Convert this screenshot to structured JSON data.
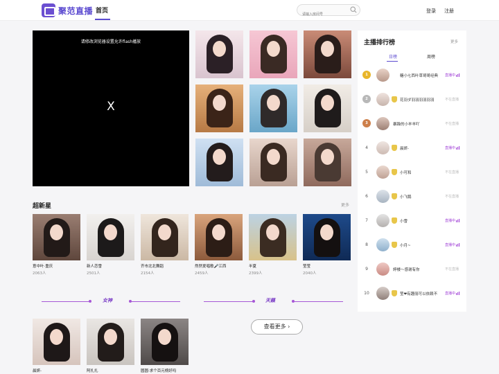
{
  "header": {
    "logo_text": "聚范直播",
    "nav_home": "首页",
    "search_placeholder": "请输入房间号",
    "login": "登录",
    "register": "注册"
  },
  "player": {
    "message": "请修改浏览器设置允许flash播放",
    "close_glyph": "X"
  },
  "section": {
    "title": "超新星",
    "more": "更多"
  },
  "stars": [
    {
      "name": "意中叶·重庆",
      "count": "2063人"
    },
    {
      "name": "新人恋雪",
      "count": "2501人"
    },
    {
      "name": "齐市北北舞蹈",
      "count": "2154人"
    },
    {
      "name": "然然爱唱歌🎤江西",
      "count": "2459人"
    },
    {
      "name": "半夏",
      "count": "2399人"
    },
    {
      "name": "莹莹",
      "count": "2040人"
    }
  ],
  "dividers": {
    "left": "女神",
    "right": "天籁"
  },
  "bottom_cards": [
    {
      "name": "晨妍-"
    },
    {
      "name": "阿扎扎"
    },
    {
      "name": "圆圆·求个百元榜好吗"
    }
  ],
  "more_button": "查看更多",
  "ranking": {
    "title": "主播排行榜",
    "more": "更多",
    "tab_daily": "日榜",
    "tab_weekly": "周榜",
    "rows": [
      {
        "rank": "1",
        "name": "糖小七西叶草哥哥经典",
        "status": "直播中",
        "live": true
      },
      {
        "rank": "2",
        "name": "花羽ダ羽羽羽羽羽羽",
        "status": "不在直播",
        "live": false
      },
      {
        "rank": "3",
        "name": "暴躁的小羊羊吖",
        "status": "不在直播",
        "live": false
      },
      {
        "rank": "4",
        "name": "晨妍-",
        "status": "直播中",
        "live": true
      },
      {
        "rank": "5",
        "name": "小可和",
        "status": "不在直播",
        "live": false
      },
      {
        "rank": "6",
        "name": "小飞鹅",
        "status": "不在直播",
        "live": false
      },
      {
        "rank": "7",
        "name": "小雪",
        "status": "直播中",
        "live": true
      },
      {
        "rank": "8",
        "name": "小月~",
        "status": "直播中",
        "live": true
      },
      {
        "rank": "9",
        "name": "婷楼～感谢有你",
        "status": "不在直播",
        "live": false
      },
      {
        "rank": "10",
        "name": "莹❤有趣丽可以依赖不",
        "status": "直播中",
        "live": true
      }
    ]
  },
  "colors": {
    "brand": "#5b4ad0",
    "live": "#a03fd6",
    "gold": "#e8b52a",
    "silver": "#b8b8b8",
    "bronze": "#cd7f4a"
  }
}
